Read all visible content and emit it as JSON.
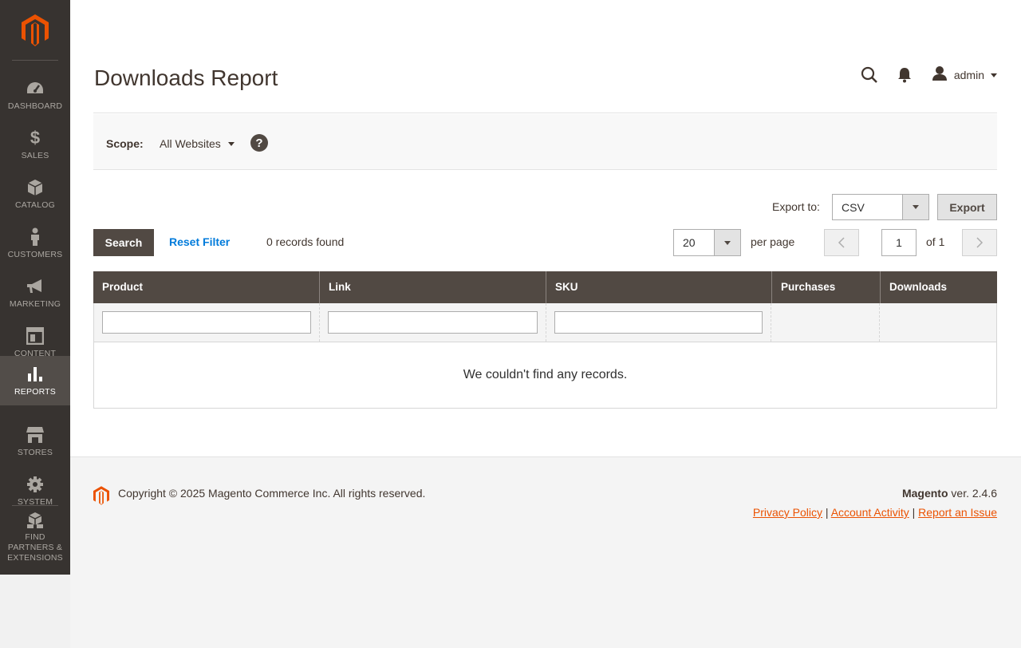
{
  "sidebar": {
    "logo": "magento-logo",
    "items": [
      {
        "label": "DASHBOARD",
        "icon": "dashboard-icon"
      },
      {
        "label": "SALES",
        "icon": "dollar-icon"
      },
      {
        "label": "CATALOG",
        "icon": "box-icon"
      },
      {
        "label": "CUSTOMERS",
        "icon": "person-icon"
      },
      {
        "label": "MARKETING",
        "icon": "megaphone-icon"
      },
      {
        "label": "CONTENT",
        "icon": "layout-icon"
      },
      {
        "label": "REPORTS",
        "icon": "bar-chart-icon",
        "active": true
      },
      {
        "label": "STORES",
        "icon": "storefront-icon"
      },
      {
        "label": "SYSTEM",
        "icon": "gear-icon"
      },
      {
        "label": "FIND PARTNERS & EXTENSIONS",
        "icon": "cubes-icon"
      }
    ]
  },
  "header": {
    "title": "Downloads Report",
    "user": "admin"
  },
  "scope": {
    "label": "Scope:",
    "value": "All Websites",
    "help": "?"
  },
  "export": {
    "label": "Export to:",
    "format": "CSV",
    "button": "Export"
  },
  "toolbar": {
    "search": "Search",
    "reset": "Reset Filter",
    "records": "0 records found",
    "per_page_value": "20",
    "per_page_label": "per page",
    "page": "1",
    "of_pages": "of 1"
  },
  "grid": {
    "columns": [
      "Product",
      "Link",
      "SKU",
      "Purchases",
      "Downloads"
    ],
    "empty": "We couldn't find any records."
  },
  "footer": {
    "copyright": "Copyright © 2025 Magento Commerce Inc. All rights reserved.",
    "brand": "Magento",
    "version": " ver. 2.4.6",
    "links": [
      "Privacy Policy",
      "Account Activity",
      "Report an Issue"
    ]
  },
  "colors": {
    "accent": "#eb5202",
    "sidebar": "#373330",
    "header_row": "#514943",
    "link": "#007bdb"
  }
}
